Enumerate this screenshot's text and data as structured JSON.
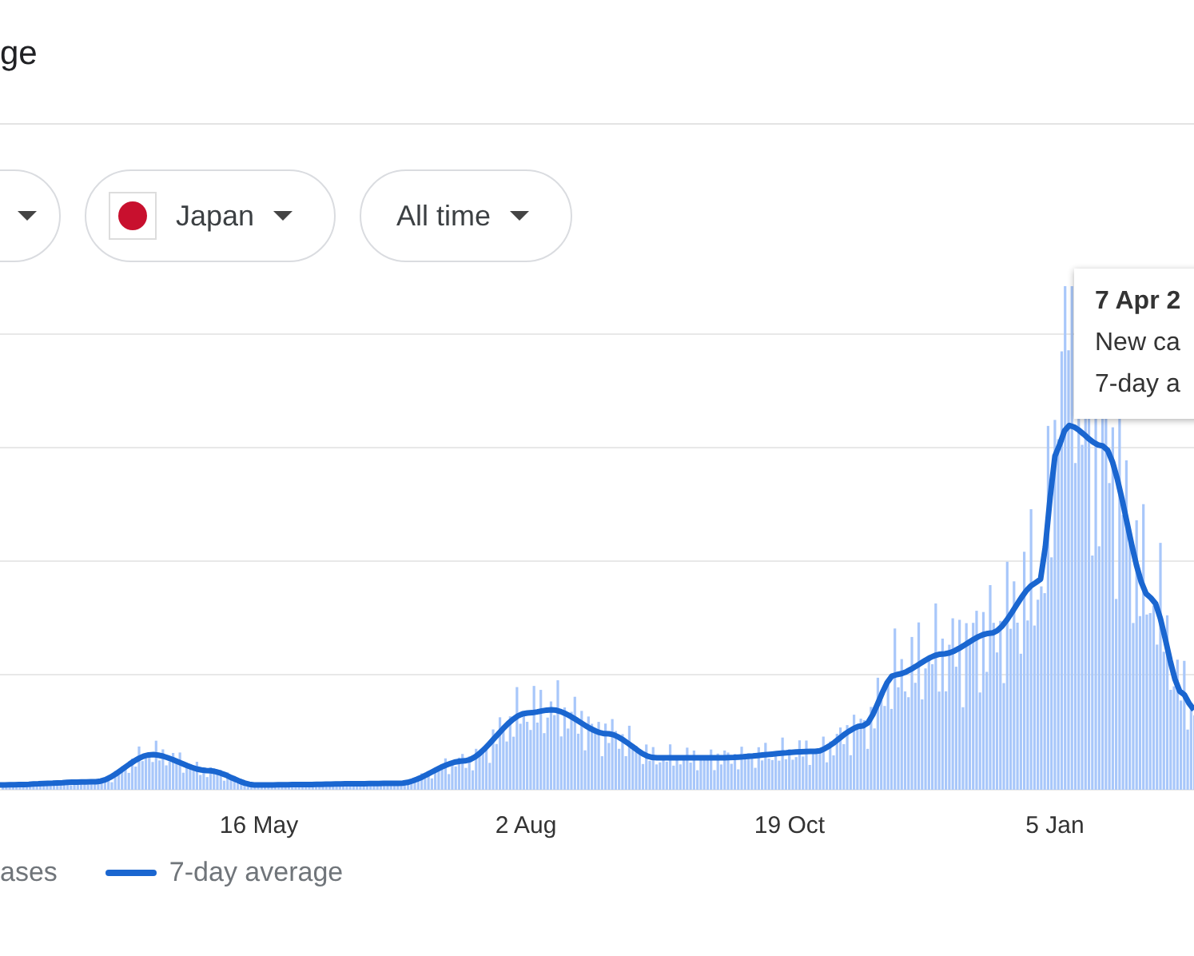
{
  "header": {
    "title": "ge"
  },
  "filters": [
    {
      "kind": "partial"
    },
    {
      "kind": "flag",
      "label": "Japan"
    },
    {
      "kind": "plain",
      "label": "All time"
    }
  ],
  "chart": {
    "x_labels": [
      "16 May",
      "2 Aug",
      "19 Oct",
      "5 Jan"
    ],
    "tooltip": {
      "date": "7 Apr 2",
      "lines": [
        "New ca",
        "7-day a"
      ]
    },
    "legend": [
      {
        "kind": "bars",
        "label": "ases"
      },
      {
        "kind": "line",
        "label": "7-day average"
      }
    ]
  }
}
